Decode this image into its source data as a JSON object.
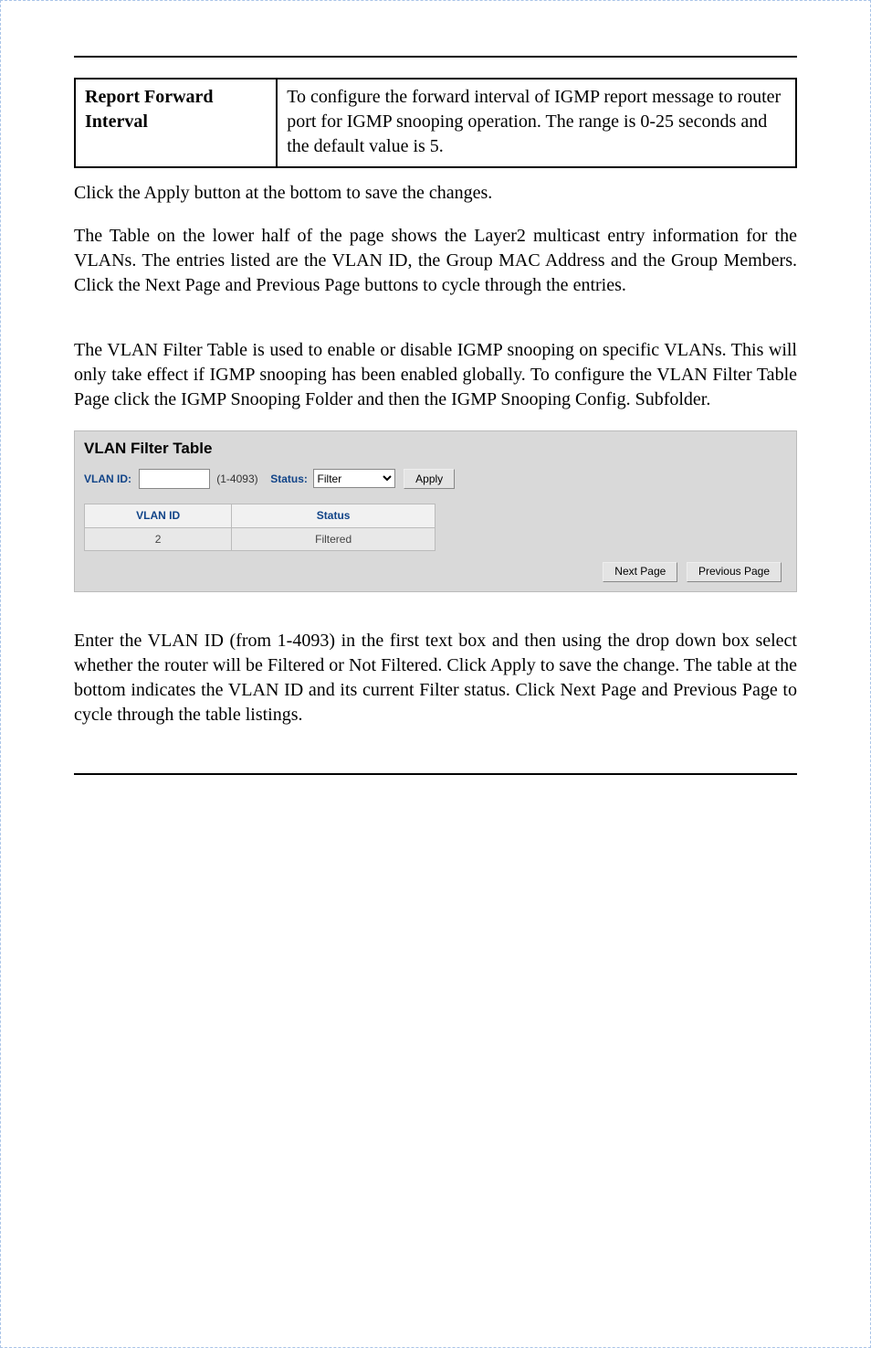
{
  "defn_table": {
    "term": "Report Forward Interval",
    "desc": "To configure the forward interval of IGMP report message to router port for IGMP snooping operation. The range is 0-25 seconds and the default value is 5."
  },
  "paragraphs": {
    "p1": "Click the Apply button at the bottom to save the changes.",
    "p2": "The Table on the lower half of the page shows the Layer2 multicast entry information for the VLANs.  The entries listed are the VLAN ID, the Group MAC Address and the Group Members.   Click the Next Page and Previous Page buttons to cycle through the entries.",
    "p3": "The VLAN Filter Table is used to enable or disable IGMP snooping on specific VLANs.  This will only take effect if IGMP snooping has been enabled globally.  To configure the VLAN Filter Table Page click the IGMP Snooping Folder and then the IGMP Snooping Config. Subfolder.",
    "p4": "Enter the VLAN ID (from 1-4093) in the first text box and then using the drop down box select whether the router will be Filtered or Not Filtered.  Click Apply to save the change.  The table at the bottom indicates the VLAN ID and its current Filter status.  Click Next Page and Previous Page to cycle through the table listings."
  },
  "panel": {
    "title": "VLAN Filter Table",
    "vlan_id_label": "VLAN ID:",
    "vlan_id_value": "",
    "vlan_id_range": "(1-4093)",
    "status_label": "Status:",
    "status_selected": "Filter",
    "apply_label": "Apply",
    "table": {
      "col1_header": "VLAN ID",
      "col2_header": "Status",
      "rows": [
        {
          "id": "2",
          "status": "Filtered"
        }
      ]
    },
    "next_label": "Next Page",
    "prev_label": "Previous Page"
  }
}
